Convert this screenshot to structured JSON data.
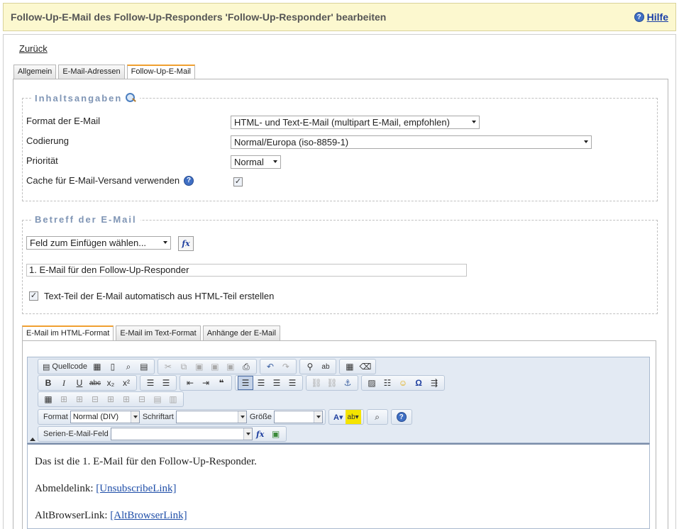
{
  "header": {
    "title": "Follow-Up-E-Mail des Follow-Up-Responders 'Follow-Up-Responder' bearbeiten",
    "help_label": "Hilfe"
  },
  "back_link": "Zurück",
  "tabs": [
    {
      "label": "Allgemein"
    },
    {
      "label": "E-Mail-Adressen"
    },
    {
      "label": "Follow-Up-E-Mail"
    }
  ],
  "section_content": {
    "legend": "Inhaltsangaben",
    "format_label": "Format der E-Mail",
    "format_value": "HTML- und Text-E-Mail (multipart E-Mail, empfohlen)",
    "encoding_label": "Codierung",
    "encoding_value": "Normal/Europa (iso-8859-1)",
    "priority_label": "Priorität",
    "priority_value": "Normal",
    "cache_label": "Cache für E-Mail-Versand verwenden",
    "cache_checked": true
  },
  "section_subject": {
    "legend": "Betreff der E-Mail",
    "insert_field_value": "Feld zum Einfügen wählen...",
    "fx_label": "fx",
    "subject_value": "1. E-Mail für den Follow-Up-Responder",
    "auto_text_label": "Text-Teil der E-Mail automatisch aus HTML-Teil erstellen",
    "auto_text_checked": true
  },
  "editor_tabs": [
    {
      "label": "E-Mail im HTML-Format"
    },
    {
      "label": "E-Mail im Text-Format"
    },
    {
      "label": "Anhänge der E-Mail"
    }
  ],
  "toolbar": {
    "source_label": "Quellcode",
    "format_label": "Format",
    "format_value": "Normal (DIV)",
    "font_label": "Schriftart",
    "font_value": "",
    "size_label": "Größe",
    "size_value": "",
    "mergefield_label": "Serien-E-Mail-Feld",
    "mergefield_value": "",
    "fx_label": "fx"
  },
  "content": {
    "line1": "Das ist die 1. E-Mail für den Follow-Up-Responder.",
    "unsub_label": "Abmeldelink:",
    "unsub_link": "[UnsubscribeLink]",
    "altbrowser_label": "AltBrowserLink:",
    "altbrowser_link": "[AltBrowserLink]"
  },
  "colors": {
    "header_bg": "#fcf8cf",
    "legend": "#7f95b5",
    "active_tab_accent": "#f0a030",
    "link": "#1f4ea8"
  }
}
